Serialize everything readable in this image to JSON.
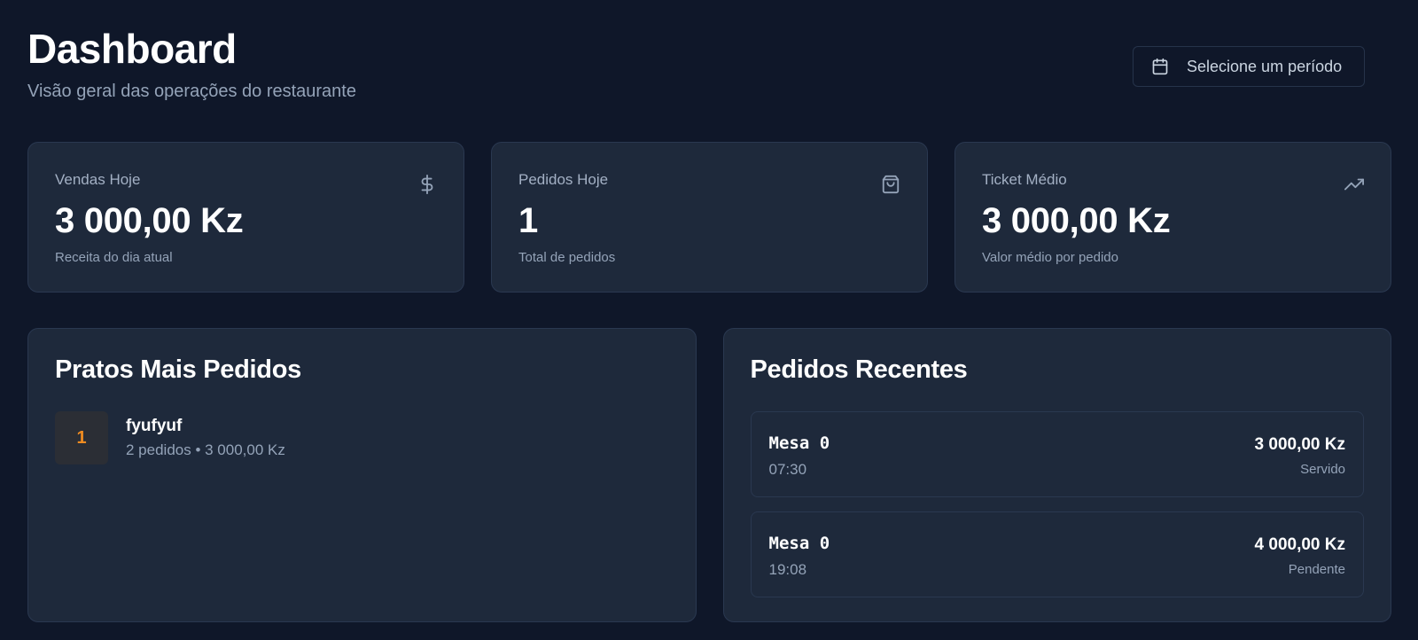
{
  "header": {
    "title": "Dashboard",
    "subtitle": "Visão geral das operações do restaurante",
    "period_button": {
      "label": "Selecione um período",
      "icon": "calendar-icon"
    }
  },
  "stats": [
    {
      "label": "Vendas Hoje",
      "value": "3 000,00 Kz",
      "description": "Receita do dia atual",
      "icon": "dollar-icon"
    },
    {
      "label": "Pedidos Hoje",
      "value": "1",
      "description": "Total de pedidos",
      "icon": "shopping-bag-icon"
    },
    {
      "label": "Ticket Médio",
      "value": "3 000,00 Kz",
      "description": "Valor médio por pedido",
      "icon": "trending-up-icon"
    }
  ],
  "top_dishes": {
    "title": "Pratos Mais Pedidos",
    "items": [
      {
        "rank": "1",
        "name": "fyufyuf",
        "meta": "2 pedidos • 3 000,00 Kz"
      }
    ]
  },
  "recent_orders": {
    "title": "Pedidos Recentes",
    "items": [
      {
        "table": "Mesa 0",
        "time": "07:30",
        "amount": "3 000,00 Kz",
        "status": "Servido"
      },
      {
        "table": "Mesa 0",
        "time": "19:08",
        "amount": "4 000,00 Kz",
        "status": "Pendente"
      }
    ]
  },
  "colors": {
    "background": "#0f1729",
    "card": "#1e293b",
    "border": "#2a3850",
    "muted_text": "#94a3b8",
    "rank_accent": "#f08c21"
  }
}
